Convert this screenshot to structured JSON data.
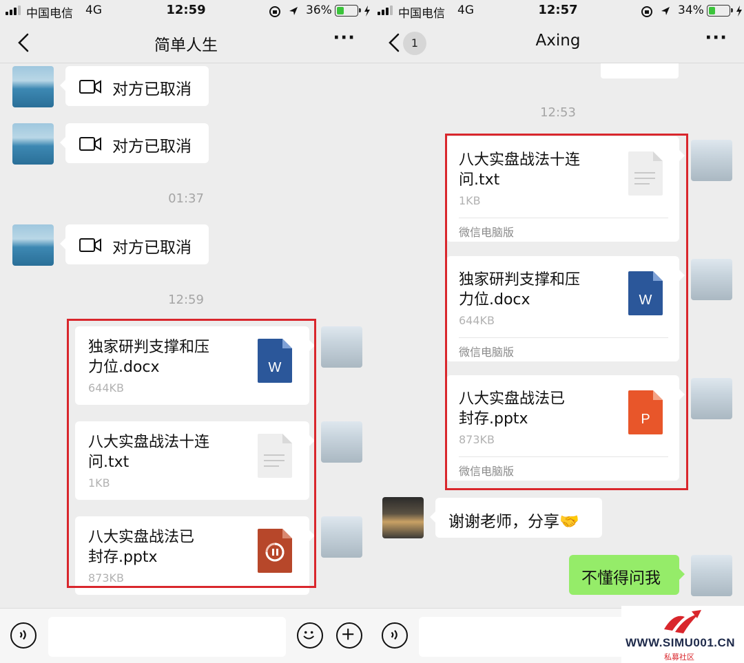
{
  "left": {
    "status": {
      "carrier": "中国电信",
      "network": "4G",
      "time": "12:59",
      "battery_pct": "36%",
      "battery_level": 0.36
    },
    "nav": {
      "title": "简单人生",
      "more": "···"
    },
    "messages": {
      "call1": "对方已取消",
      "call2": "对方已取消",
      "time1": "01:37",
      "call3": "对方已取消",
      "time2": "12:59"
    },
    "files": [
      {
        "name_line1": "独家研判支撑和压",
        "name_line2": "力位.docx",
        "size": "644KB",
        "icon": "word-icon",
        "letter": "W",
        "color": "#2b579a"
      },
      {
        "name_line1": "八大实盘战法十连",
        "name_line2": "问.txt",
        "size": "1KB",
        "icon": "text-file-icon",
        "letter": "",
        "color": "#f0f0f0"
      },
      {
        "name_line1": "八大实盘战法已",
        "name_line2": "封存.pptx",
        "size": "873KB",
        "icon": "powerpoint-loading-icon",
        "letter": "",
        "color": "#b7472a"
      }
    ]
  },
  "right": {
    "status": {
      "carrier": "中国电信",
      "network": "4G",
      "time": "12:57",
      "battery_pct": "34%",
      "battery_level": 0.34
    },
    "nav": {
      "title": "Axing",
      "badge": "1",
      "more": "···"
    },
    "time1": "12:53",
    "files": [
      {
        "name_line1": "八大实盘战法十连",
        "name_line2": "问.txt",
        "size": "1KB",
        "source": "微信电脑版",
        "icon": "text-file-icon",
        "letter": "",
        "color": "#f0f0f0"
      },
      {
        "name_line1": "独家研判支撑和压",
        "name_line2": "力位.docx",
        "size": "644KB",
        "source": "微信电脑版",
        "icon": "word-icon",
        "letter": "W",
        "color": "#2b579a"
      },
      {
        "name_line1": "八大实盘战法已",
        "name_line2": "封存.pptx",
        "size": "873KB",
        "source": "微信电脑版",
        "icon": "powerpoint-icon",
        "letter": "P",
        "color": "#e8562a"
      }
    ],
    "reply": "谢谢老师，分享🤝",
    "sent": "不懂得问我"
  },
  "watermark": {
    "text": "WWW.SIMU001.CN",
    "sub": "私募社区"
  }
}
